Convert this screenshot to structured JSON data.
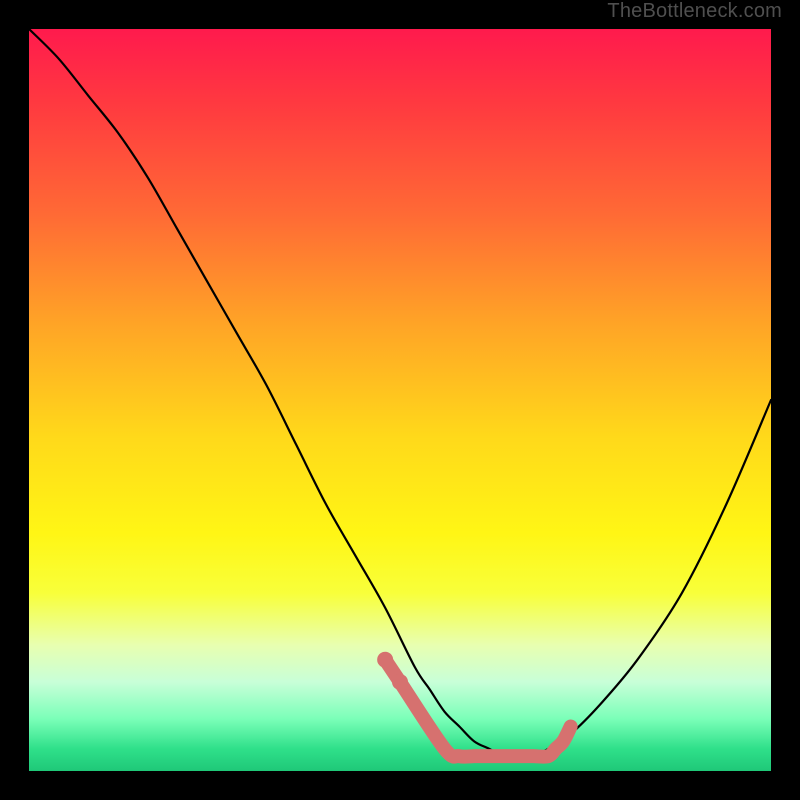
{
  "credit": "TheBottleneck.com",
  "chart_data": {
    "type": "line",
    "title": "",
    "xlabel": "",
    "ylabel": "",
    "xlim": [
      0,
      100
    ],
    "ylim": [
      0,
      100
    ],
    "series": [
      {
        "name": "bottleneck-curve",
        "x": [
          0,
          4,
          8,
          12,
          16,
          20,
          24,
          28,
          32,
          36,
          40,
          44,
          48,
          52,
          54,
          56,
          58,
          60,
          62,
          64,
          66,
          68,
          70,
          73,
          77,
          82,
          88,
          94,
          100
        ],
        "y": [
          100,
          96,
          91,
          86,
          80,
          73,
          66,
          59,
          52,
          44,
          36,
          29,
          22,
          14,
          11,
          8,
          6,
          4,
          3,
          2,
          2,
          2,
          3,
          5,
          9,
          15,
          24,
          36,
          50
        ]
      }
    ],
    "markers": {
      "name": "highlight-band",
      "color": "#d6716f",
      "points_x": [
        48,
        50,
        56,
        58,
        60,
        62,
        64,
        66,
        68,
        70,
        71,
        72,
        73
      ],
      "points_y": [
        15,
        12,
        3,
        2,
        2,
        2,
        2,
        2,
        2,
        2,
        3,
        4,
        6
      ]
    }
  }
}
